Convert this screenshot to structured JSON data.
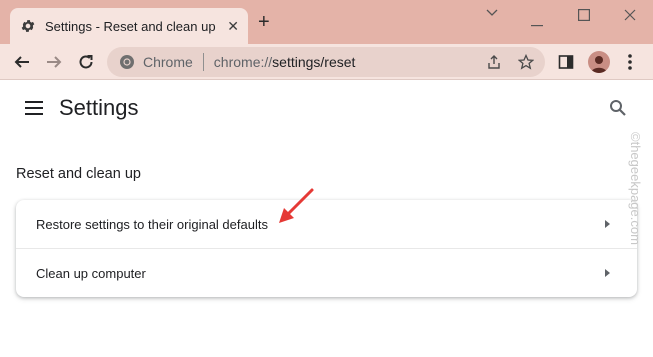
{
  "window": {
    "tab_title": "Settings - Reset and clean up",
    "tab_close": "✕",
    "new_tab": "+",
    "minimize": "—",
    "maximize": "☐",
    "close": "✕"
  },
  "toolbar": {
    "back": "←",
    "forward": "→",
    "reload": "↻",
    "site_chip": "Chrome",
    "url_scheme": "chrome://",
    "url_path": "settings/reset",
    "icons": [
      "share-icon",
      "bookmark-star-icon",
      "side-panel-icon",
      "profile-avatar",
      "more-menu-icon"
    ]
  },
  "settings": {
    "title": "Settings",
    "section_title": "Reset and clean up",
    "rows": [
      {
        "label": "Restore settings to their original defaults"
      },
      {
        "label": "Clean up computer"
      }
    ]
  },
  "watermark": "©thegeekpage.com",
  "colors": {
    "titlebar": "#e4b3a8",
    "toolbar": "#f6e4df",
    "omnibox": "#e8d2cc",
    "annotation_arrow": "#e53935"
  }
}
